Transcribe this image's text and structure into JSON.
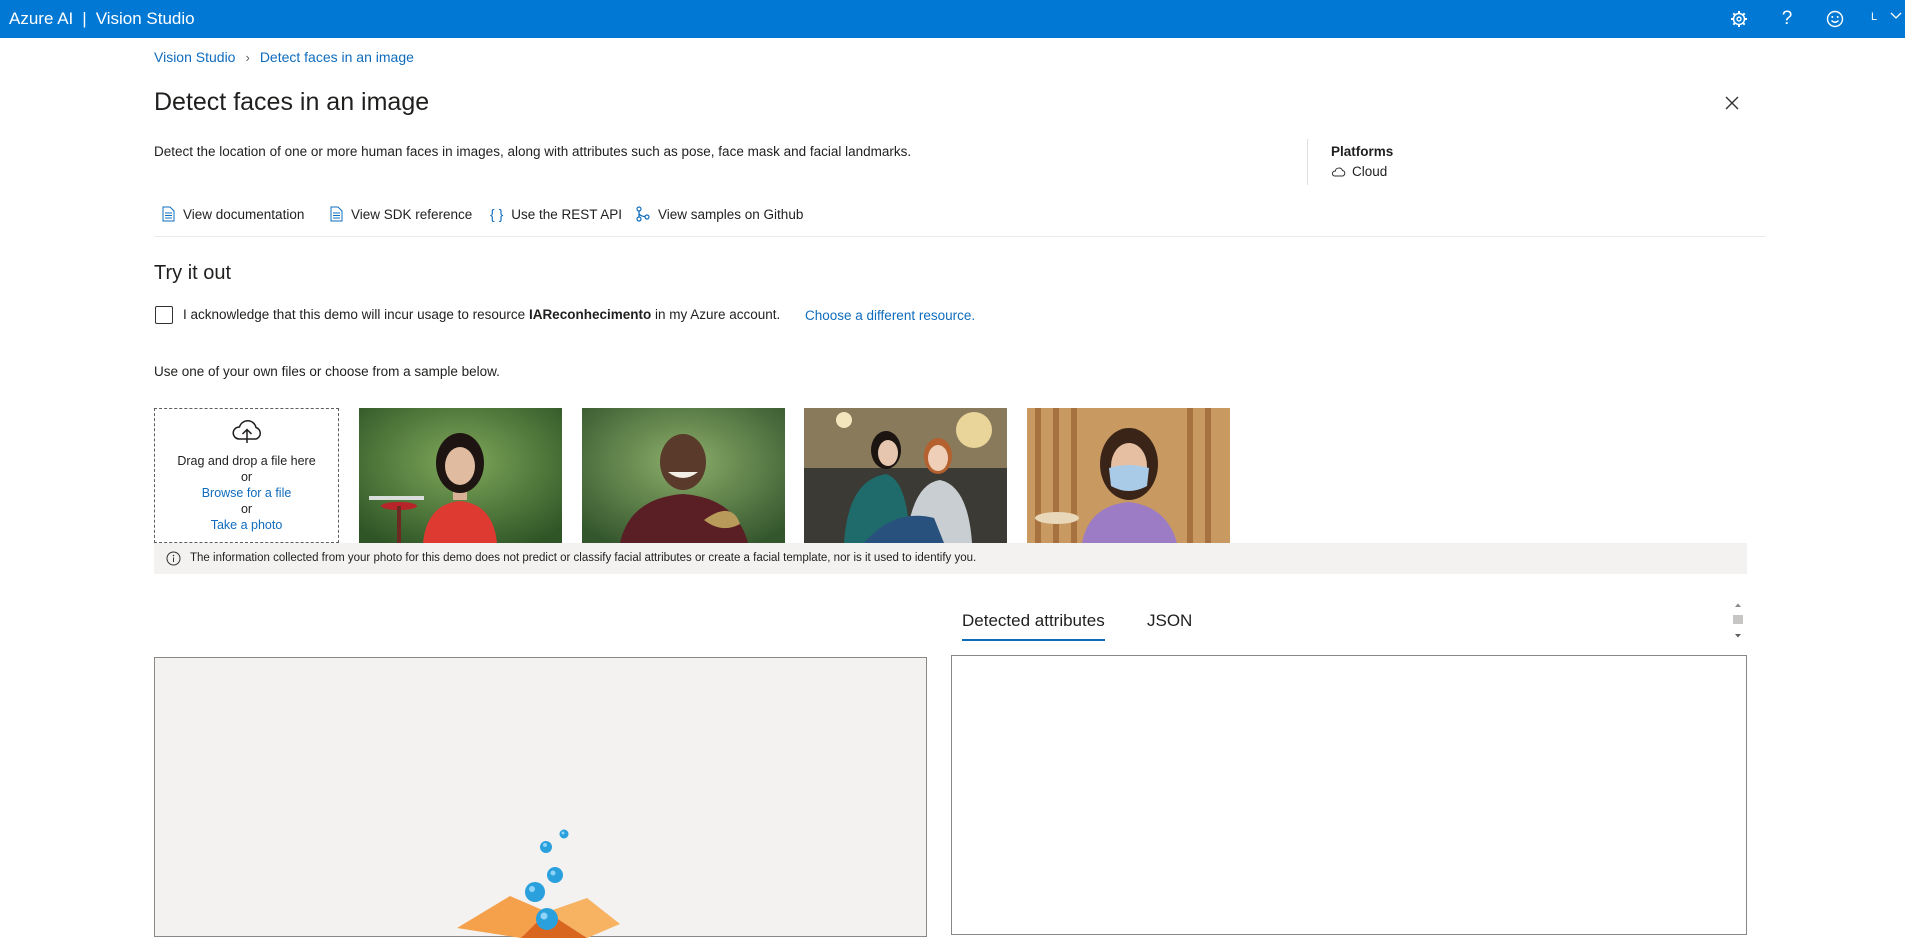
{
  "app": {
    "brand": "Azure AI",
    "product": "Vision Studio",
    "user_initial": "L"
  },
  "breadcrumb": {
    "root": "Vision Studio",
    "current": "Detect faces in an image"
  },
  "page": {
    "title": "Detect faces in an image",
    "description": "Detect the location of one or more human faces in images, along with attributes such as pose, face mask and facial landmarks.",
    "platforms_label": "Platforms",
    "platforms_value": "Cloud"
  },
  "links": {
    "documentation": "View documentation",
    "sdk": "View SDK reference",
    "rest": "Use the REST API",
    "github": "View samples on Github"
  },
  "tryit": {
    "heading": "Try it out",
    "ack_prefix": "I acknowledge that this demo will incur usage to resource ",
    "resource": "IAReconhecimento",
    "ack_suffix": " in my Azure account.",
    "choose": "Choose a different resource.",
    "use_hint": "Use one of your own files or choose from a sample below."
  },
  "dropzone": {
    "drag": "Drag and drop a file here",
    "or1": "or",
    "browse": "Browse for a file",
    "or2": "or",
    "photo": "Take a photo"
  },
  "info": "The information collected from your photo for this demo does not predict or classify facial attributes or create a facial template, nor is it used to identify you.",
  "tabs": {
    "attributes": "Detected attributes",
    "json": "JSON"
  },
  "colors": {
    "accent": "#0078d4",
    "link": "#0f6cbd",
    "panel_bg": "#f3f2f1"
  }
}
